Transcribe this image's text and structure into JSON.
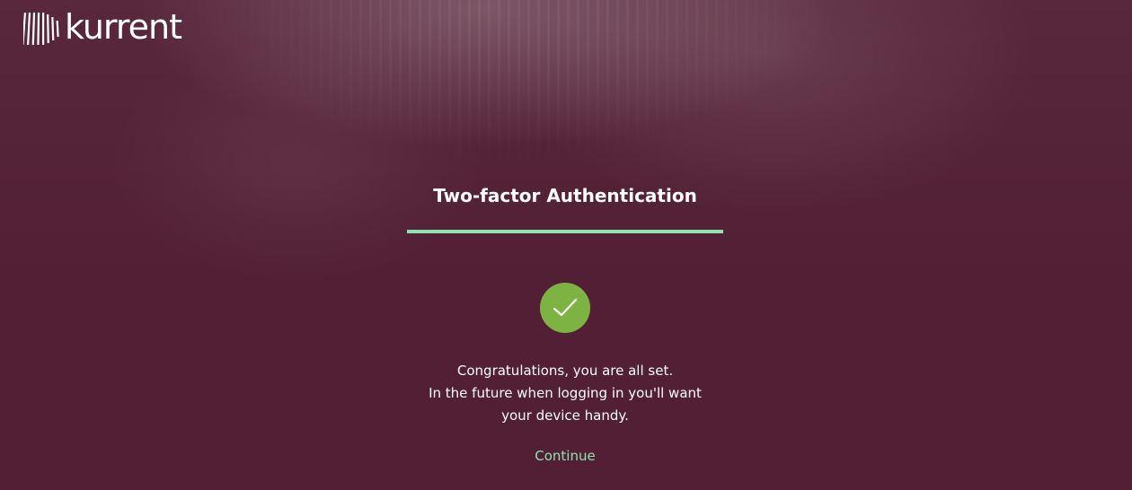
{
  "brand": {
    "name": "kurrent",
    "logo_icon": "kurrent-stripes-logo-icon"
  },
  "auth": {
    "title": "Two-factor Authentication",
    "progress_fraction": 1.0,
    "status_icon": "check-circle-icon",
    "message_lines": [
      "Congratulations, you are all set.",
      "In the future when logging in you'll want",
      "your device handy."
    ],
    "continue_label": "Continue"
  },
  "colors": {
    "background": "#521f34",
    "accent": "#8fe0b2",
    "success": "#7cb342",
    "text": "#ffffff"
  }
}
